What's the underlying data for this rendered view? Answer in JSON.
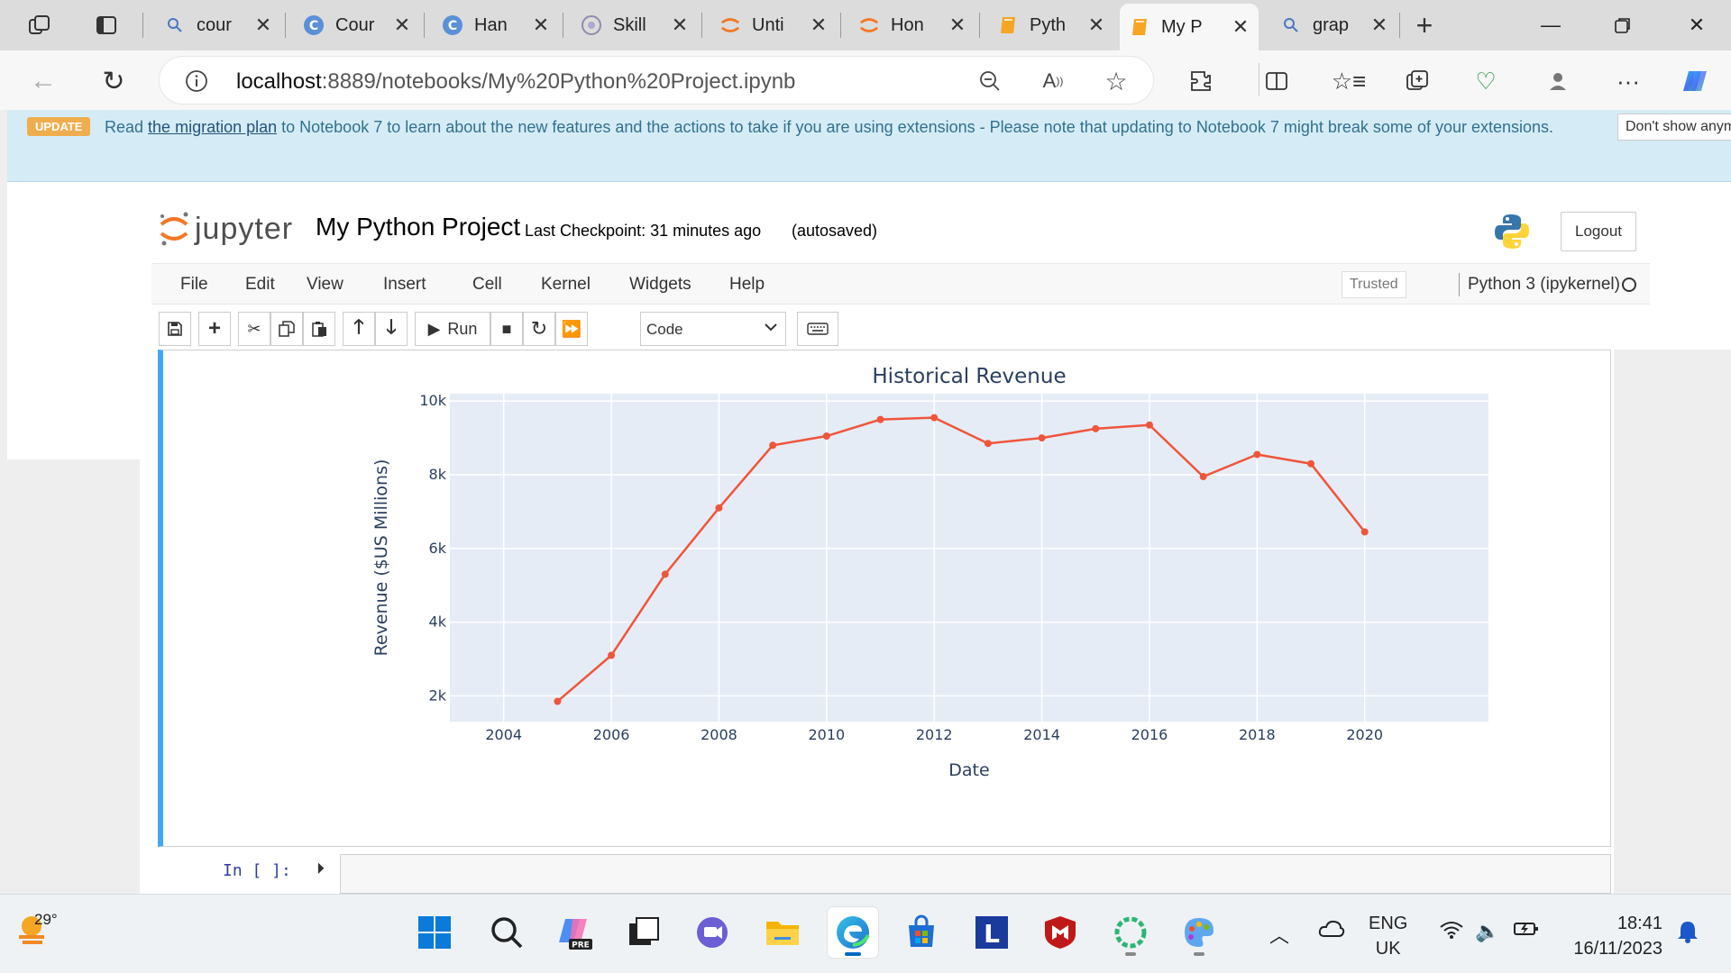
{
  "browser": {
    "tabs": [
      {
        "title": "cour",
        "favicon": "search-icon"
      },
      {
        "title": "Cour",
        "favicon": "c-icon"
      },
      {
        "title": "Han",
        "favicon": "c-icon"
      },
      {
        "title": "Skill",
        "favicon": "skills-icon"
      },
      {
        "title": "Unti",
        "favicon": "jupyter-icon"
      },
      {
        "title": "Hon",
        "favicon": "jupyter-icon"
      },
      {
        "title": "Pyth",
        "favicon": "notebook-icon"
      },
      {
        "title": "My P",
        "favicon": "notebook-icon",
        "active": true
      },
      {
        "title": "grap",
        "favicon": "search-icon"
      }
    ],
    "url_host": "localhost",
    "url_path": ":8889/notebooks/My%20Python%20Project.ipynb"
  },
  "banner": {
    "badge": "UPDATE",
    "text_before": "Read ",
    "link": "the migration plan",
    "text_after": " to Notebook 7 to learn about the new features and the actions to take if you are using extensions - Please note that updating to Notebook 7 might break some of your extensions.",
    "dismiss": "Don't show anymore"
  },
  "notebook": {
    "logo_text": "jupyter",
    "title": "My Python Project",
    "checkpoint": "Last Checkpoint: 31 minutes ago",
    "autosaved": "(autosaved)",
    "logout": "Logout",
    "menu": [
      "File",
      "Edit",
      "View",
      "Insert",
      "Cell",
      "Kernel",
      "Widgets",
      "Help"
    ],
    "trusted": "Trusted",
    "kernel": "Python 3 (ipykernel)",
    "run_label": "Run",
    "cell_type": "Code",
    "in_prompt": "In [ ]:"
  },
  "chart_data": {
    "type": "line",
    "title": "Historical Revenue",
    "xlabel": "Date",
    "ylabel": "Revenue ($US Millions)",
    "x": [
      2005,
      2006,
      2007,
      2008,
      2009,
      2010,
      2011,
      2012,
      2013,
      2014,
      2015,
      2016,
      2017,
      2018,
      2019,
      2020
    ],
    "y": [
      1850,
      3100,
      5300,
      7100,
      8800,
      9050,
      9500,
      9550,
      8850,
      9000,
      9250,
      9350,
      7950,
      8550,
      8300,
      6450
    ],
    "xlim": [
      2003,
      2022.3
    ],
    "ylim": [
      1300,
      10200
    ],
    "x_ticks": [
      2004,
      2006,
      2008,
      2010,
      2012,
      2014,
      2016,
      2018,
      2020
    ],
    "y_ticks": [
      2000,
      4000,
      6000,
      8000,
      10000
    ],
    "y_tick_labels": [
      "2k",
      "4k",
      "6k",
      "8k",
      "10k"
    ],
    "line_color": "#ef553b",
    "plot_bg": "#e5ecf6",
    "grid": true
  },
  "taskbar": {
    "temperature": "29°",
    "lang_top": "ENG",
    "lang_bottom": "UK",
    "time": "18:41",
    "date": "16/11/2023",
    "copilot_badge": "PRE",
    "l_app": "L"
  }
}
